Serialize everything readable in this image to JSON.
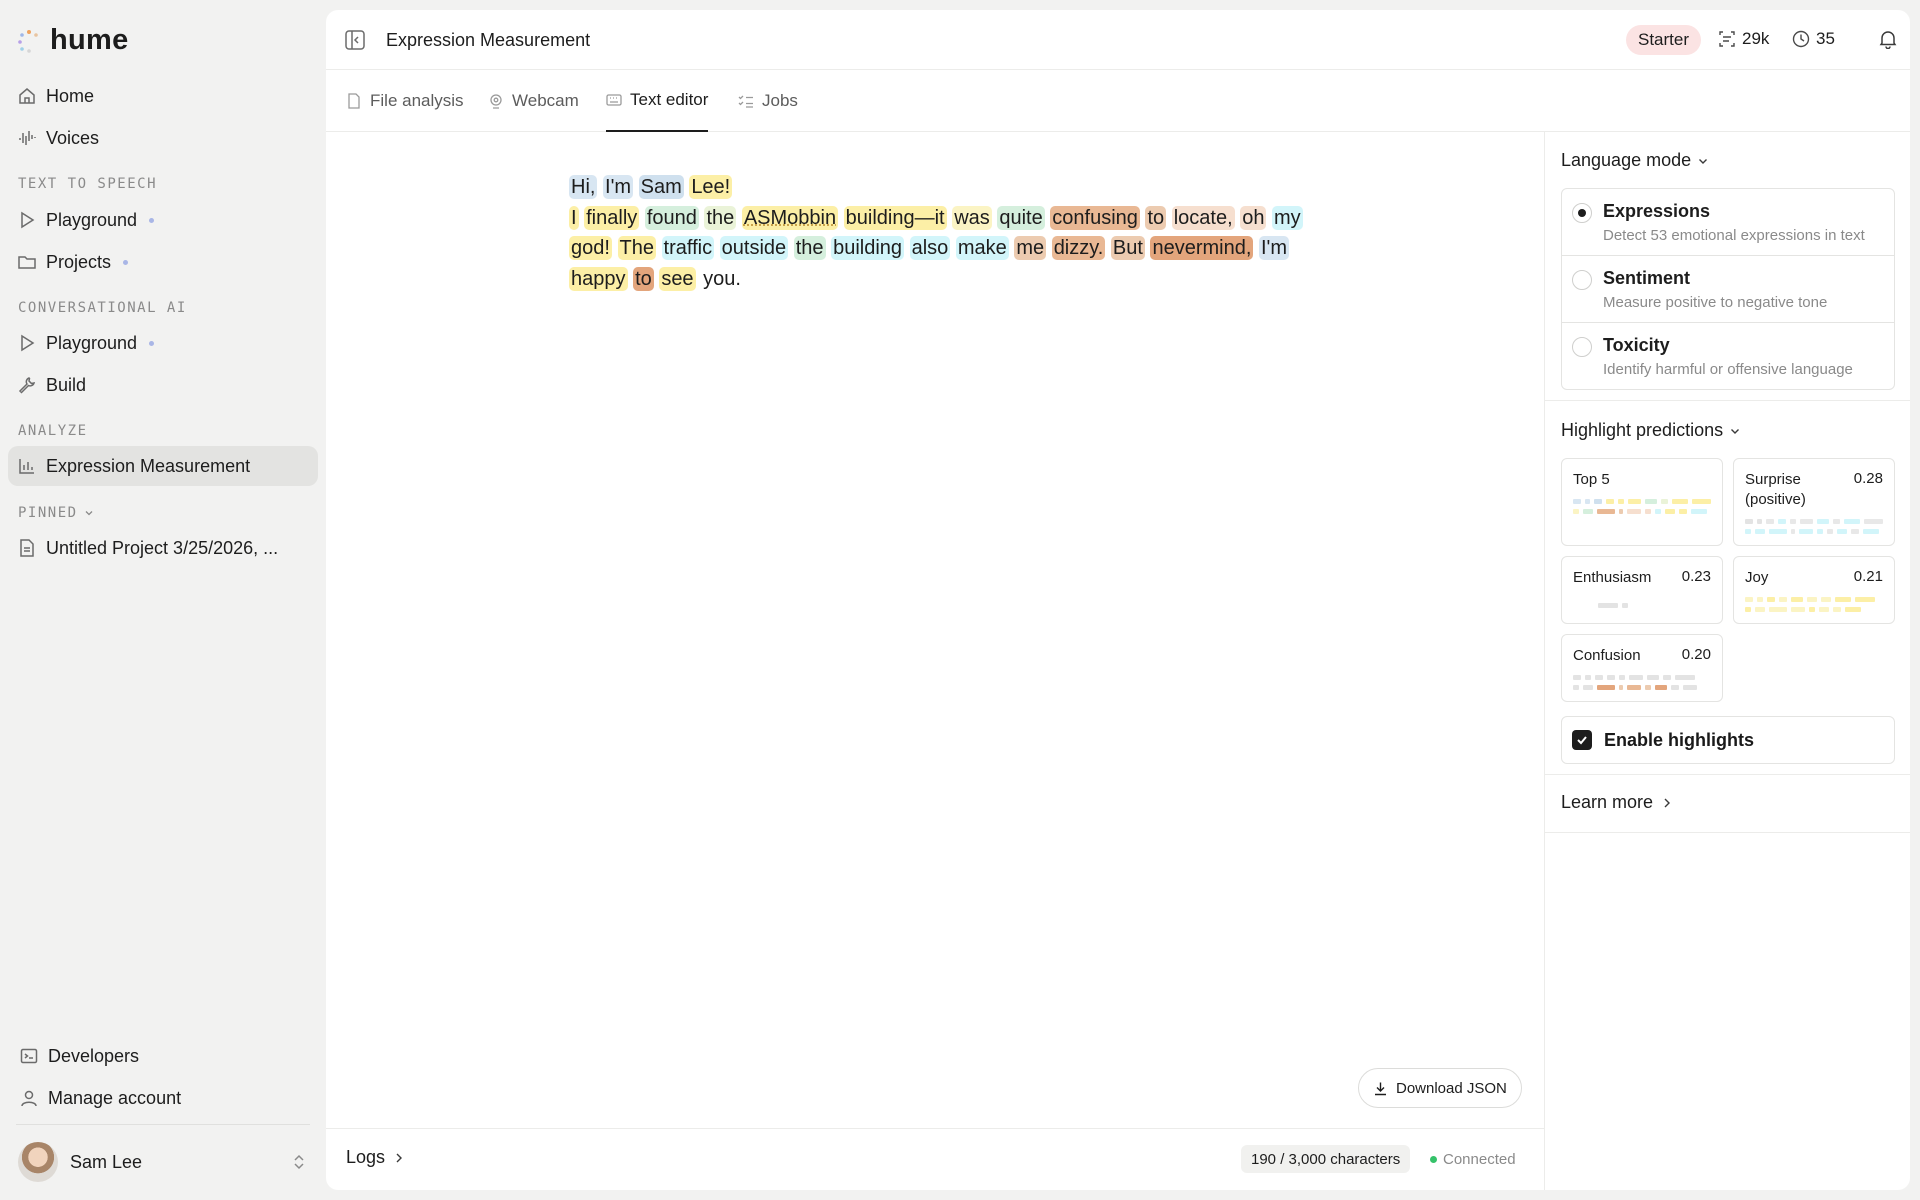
{
  "app": {
    "logo_text": "hume"
  },
  "sidebar": {
    "home": "Home",
    "voices": "Voices",
    "tts_section": "TEXT TO SPEECH",
    "tts_playground": "Playground",
    "tts_projects": "Projects",
    "cai_section": "CONVERSATIONAL AI",
    "cai_playground": "Playground",
    "cai_build": "Build",
    "analyze_section": "ANALYZE",
    "expression_measurement": "Expression Measurement",
    "pinned_section": "PINNED",
    "pinned_project": "Untitled Project 3/25/2026, ...",
    "developers": "Developers",
    "manage_account": "Manage account",
    "user_name": "Sam Lee"
  },
  "header": {
    "title": "Expression Measurement",
    "plan": "Starter",
    "characters_stat": "29k",
    "minutes_stat": "35"
  },
  "tabs": [
    "File analysis",
    "Webcam",
    "Text editor",
    "Jobs"
  ],
  "active_tab": "Text editor",
  "editor": {
    "lines": [
      [
        [
          "Hi,",
          "#d8e6f2"
        ],
        [
          "I'm",
          "#d8e6f2"
        ],
        [
          "Sam",
          "#cfe0ee"
        ],
        [
          "Lee!",
          "#fcefa6"
        ]
      ],
      [
        [
          "I",
          "#fcefa6"
        ],
        [
          "finally",
          "#fcefa6"
        ],
        [
          "found",
          "#d5efdd"
        ],
        [
          "the",
          "#eaf3d8"
        ],
        [
          "ASMobbin",
          "#fcefa6"
        ],
        [
          "building—it",
          "#fcefa6"
        ],
        [
          "was",
          "#fbf4c4"
        ],
        [
          "quite",
          "#d5efdd"
        ],
        [
          "confusing",
          "#e9b894"
        ],
        [
          "to",
          "#eccbb0"
        ],
        [
          "locate,",
          "#f6dfcf"
        ],
        [
          "oh",
          "#f6dfcf"
        ],
        [
          "my",
          "#d2f5fa"
        ]
      ],
      [
        [
          "god!",
          "#fcefa6"
        ],
        [
          "The",
          "#fcefa6"
        ],
        [
          "traffic",
          "#d2f5fa"
        ],
        [
          "outside",
          "#d2f5fa"
        ],
        [
          "the",
          "#d5efdd"
        ],
        [
          "building",
          "#d2f5fa"
        ],
        [
          "also",
          "#d2f5fa"
        ],
        [
          "make",
          "#d2f5fa"
        ],
        [
          "me",
          "#eccbb0"
        ],
        [
          "dizzy.",
          "#e9b894"
        ],
        [
          "But",
          "#eccbb0"
        ],
        [
          "nevermind,",
          "#e3a57c"
        ],
        [
          "I'm",
          "#d8e6f2"
        ]
      ],
      [
        [
          "happy",
          "#fcefa6"
        ],
        [
          "to",
          "#e3a57c"
        ],
        [
          "see",
          "#fcefa6"
        ],
        [
          "you.",
          ""
        ]
      ]
    ],
    "download_label": "Download JSON"
  },
  "footer": {
    "logs_label": "Logs",
    "char_count": "190 / 3,000 characters",
    "status": "Connected"
  },
  "panel": {
    "language_mode_label": "Language mode",
    "modes": [
      {
        "title": "Expressions",
        "desc": "Detect 53 emotional expressions in text",
        "selected": true
      },
      {
        "title": "Sentiment",
        "desc": "Measure positive to negative tone",
        "selected": false
      },
      {
        "title": "Toxicity",
        "desc": "Identify harmful or offensive language",
        "selected": false
      }
    ],
    "highlight_label": "Highlight predictions",
    "predictions": [
      {
        "name": "Top 5",
        "score": ""
      },
      {
        "name": "Surprise (positive)",
        "score": "0.28"
      },
      {
        "name": "Enthusiasm",
        "score": "0.23"
      },
      {
        "name": "Joy",
        "score": "0.21"
      },
      {
        "name": "Confusion",
        "score": "0.20"
      }
    ],
    "enable_highlights_label": "Enable highlights",
    "enable_highlights": true,
    "learn_more_label": "Learn more"
  },
  "colors": {
    "accent_dot": "#a9b6e6",
    "connected": "#35c26a",
    "plan_badge_bg": "#fbe3e3",
    "joy_yellow": "#fcefa6",
    "surprise_cyan": "#d2f5fa",
    "confusion_brown": "#e3a57c",
    "calm_blue": "#d8e6f2",
    "interest_green": "#d5efdd"
  },
  "icons": [
    "home-icon",
    "waveform-icon",
    "play-icon",
    "folder-icon",
    "wrench-icon",
    "bar-chart-icon",
    "document-icon",
    "terminal-icon",
    "user-icon",
    "chevron-updown-icon",
    "sidebar-collapse-icon",
    "credits-icon",
    "clock-icon",
    "bell-icon",
    "file-icon",
    "webcam-icon",
    "keyboard-icon",
    "jobs-icon",
    "download-icon",
    "chevron-right-icon",
    "chevron-down-icon",
    "check-icon"
  ]
}
